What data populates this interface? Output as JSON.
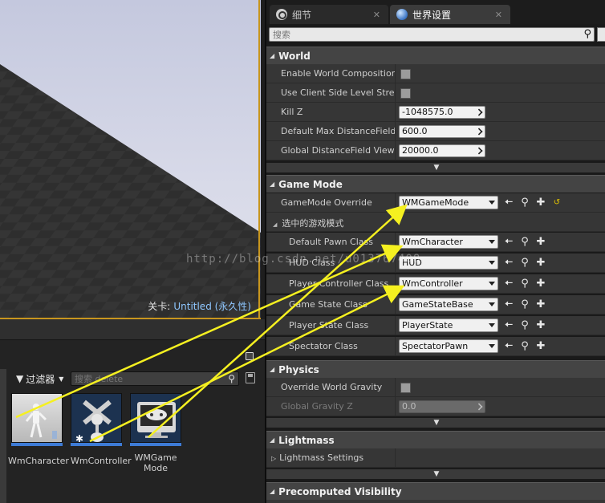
{
  "viewport": {
    "level_label_key": "关卡:",
    "level_label_value": "Untitled (永久性)"
  },
  "content_browser": {
    "filter_label": "过滤器",
    "search_placeholder": "搜索 delete",
    "assets": [
      {
        "name": "WmCharacter",
        "icon": "character-icon"
      },
      {
        "name": "WmController",
        "icon": "controller-icon"
      },
      {
        "name": "WMGame Mode",
        "icon": "gamemode-icon"
      }
    ]
  },
  "tabs": [
    {
      "label": "细节",
      "icon": "details-icon"
    },
    {
      "label": "世界设置",
      "icon": "world-icon"
    }
  ],
  "search": {
    "placeholder": "搜索"
  },
  "sections": {
    "world": {
      "title": "World",
      "enable_world_composition": "Enable World Composition",
      "use_client_side": "Use Client Side Level Streaming Volumes",
      "kill_z_label": "Kill Z",
      "kill_z_value": "-1048575.0",
      "max_df_label": "Default Max DistanceField Occlusion Distance",
      "max_df_value": "600.0",
      "global_df_label": "Global DistanceField View Distance",
      "global_df_value": "20000.0"
    },
    "game_mode": {
      "title": "Game Mode",
      "override_label": "GameMode Override",
      "override_value": "WMGameMode",
      "selected_mode": "选中的游戏模式",
      "pawn_label": "Default Pawn Class",
      "pawn_value": "WmCharacter",
      "hud_label": "HUD Class",
      "hud_value": "HUD",
      "controller_label": "Player Controller Class",
      "controller_value": "WmController",
      "state_label": "Game State Class",
      "state_value": "GameStateBase",
      "player_state_label": "Player State Class",
      "player_state_value": "PlayerState",
      "spectator_label": "Spectator Class",
      "spectator_value": "SpectatorPawn"
    },
    "physics": {
      "title": "Physics",
      "override_gravity": "Override World Gravity",
      "gravity_label": "Global Gravity Z",
      "gravity_value": "0.0"
    },
    "lightmass": {
      "title": "Lightmass",
      "settings": "Lightmass Settings"
    },
    "precomputed": {
      "title": "Precomputed Visibility"
    }
  },
  "watermark": "http://blog.csdn.net/u013767408",
  "colors": {
    "accent_blue": "#3d7bd6",
    "viewport_border": "#c8961e",
    "arrow_yellow": "#f5f020",
    "level_link": "#8fc7ff"
  }
}
